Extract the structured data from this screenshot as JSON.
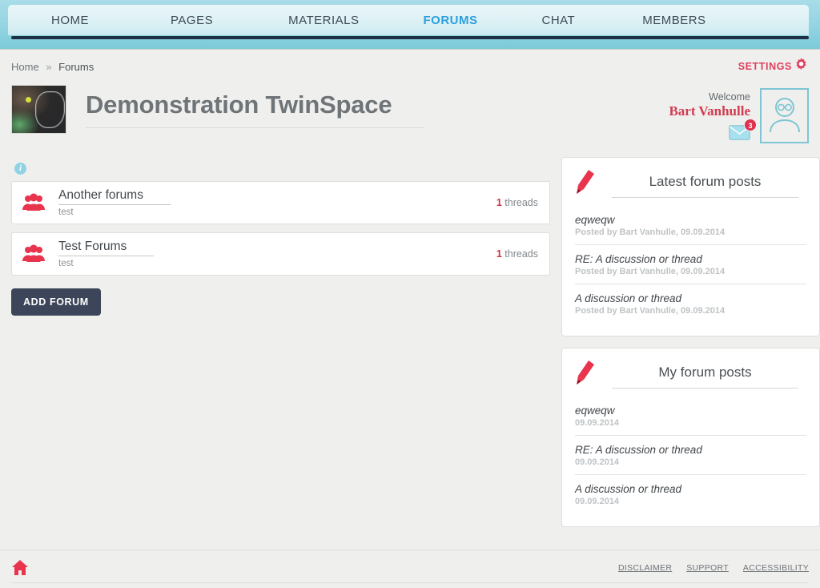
{
  "nav": {
    "items": [
      {
        "label": "HOME",
        "active": false
      },
      {
        "label": "PAGES",
        "active": false
      },
      {
        "label": "MATERIALS",
        "active": false
      },
      {
        "label": "FORUMS",
        "active": true
      },
      {
        "label": "CHAT",
        "active": false
      },
      {
        "label": "MEMBERS",
        "active": false
      }
    ]
  },
  "breadcrumb": {
    "home": "Home",
    "separator": "»",
    "current": "Forums"
  },
  "settings": {
    "label": "SETTINGS",
    "icon": "gear-icon"
  },
  "header": {
    "title": "Demonstration TwinSpace",
    "welcome_label": "Welcome",
    "user_name": "Bart Vanhulle",
    "mail_badge": "3"
  },
  "forums": {
    "info_icon": "i",
    "items": [
      {
        "name": "Another forums",
        "description": "test",
        "count": "1",
        "count_label": "threads"
      },
      {
        "name": "Test Forums",
        "description": "test",
        "count": "1",
        "count_label": "threads"
      }
    ],
    "add_button": "ADD FORUM"
  },
  "panels": [
    {
      "title": "Latest forum posts",
      "posts": [
        {
          "title": "eqweqw",
          "meta": "Posted by Bart Vanhulle, 09.09.2014"
        },
        {
          "title": "RE: A discussion or thread",
          "meta": "Posted by Bart Vanhulle, 09.09.2014"
        },
        {
          "title": "A discussion or thread",
          "meta": "Posted by Bart Vanhulle, 09.09.2014"
        }
      ]
    },
    {
      "title": "My forum posts",
      "posts": [
        {
          "title": "eqweqw",
          "meta": "09.09.2014"
        },
        {
          "title": "RE: A discussion or thread",
          "meta": "09.09.2014"
        },
        {
          "title": "A discussion or thread",
          "meta": "09.09.2014"
        }
      ]
    }
  ],
  "footer": {
    "links": [
      {
        "label": "DISCLAIMER"
      },
      {
        "label": "SUPPORT"
      },
      {
        "label": "ACCESSIBILITY"
      }
    ]
  },
  "colors": {
    "accent_red": "#d23b52",
    "accent_blue": "#2b9fe0",
    "nav_band": "#93d4e2",
    "dark_navy": "#1e3144",
    "button_navy": "#3c4559"
  }
}
